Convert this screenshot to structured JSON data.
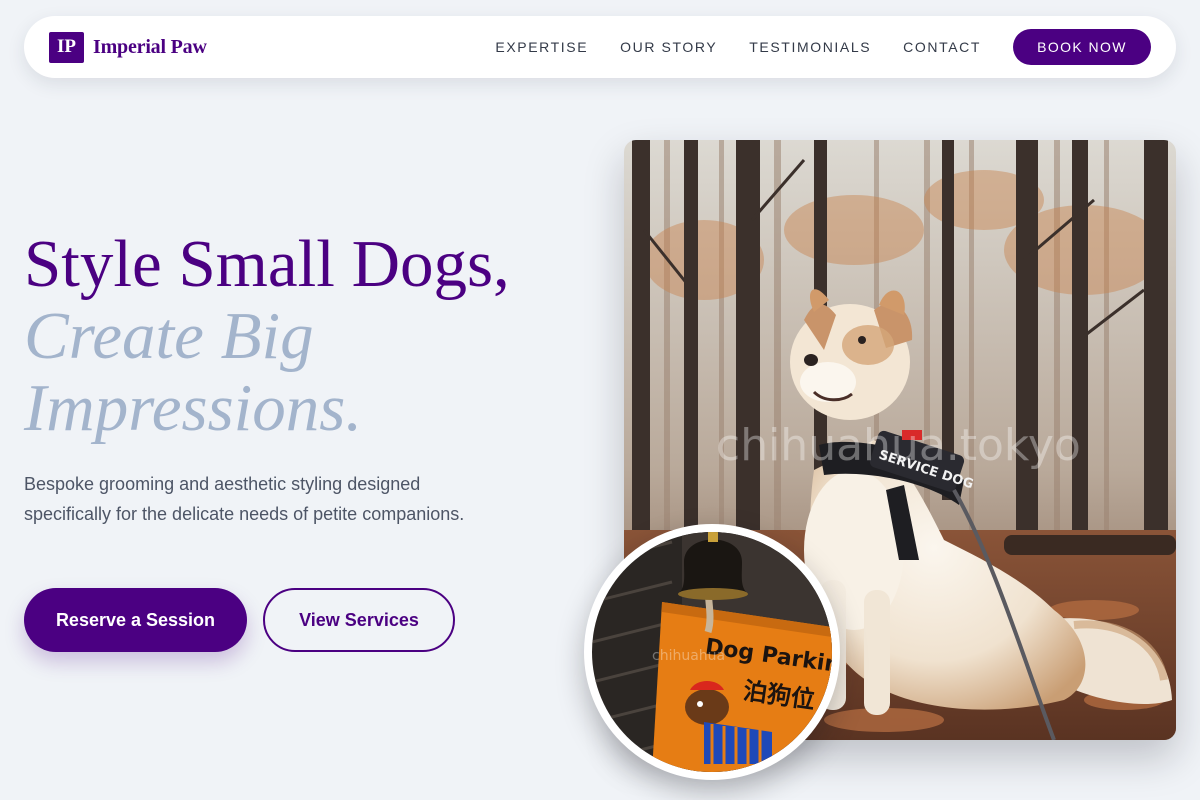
{
  "nav": {
    "logo_mark": "IP",
    "brand_name": "Imperial Paw",
    "links": [
      "EXPERTISE",
      "OUR STORY",
      "TESTIMONIALS",
      "CONTACT"
    ],
    "cta": "BOOK NOW"
  },
  "hero": {
    "headline_line1": "Style Small Dogs,",
    "headline_line2": "Create Big",
    "headline_line3": "Impressions.",
    "lede": "Bespoke grooming and aesthetic styling designed specifically for the delicate needs of petite companions.",
    "primary_cta": "Reserve a Session",
    "secondary_cta": "View Services"
  },
  "images": {
    "main_harness_text": "SERVICE DOG",
    "main_watermark": "chihuahua.tokyo",
    "inset_sign_text": "Dog Parking",
    "inset_sign_kanji": "泊狗位",
    "inset_watermark": "chihuahua"
  },
  "colors": {
    "brand": "#4b0082",
    "headline_muted": "#a3b4cc",
    "background": "#f0f3f7"
  }
}
